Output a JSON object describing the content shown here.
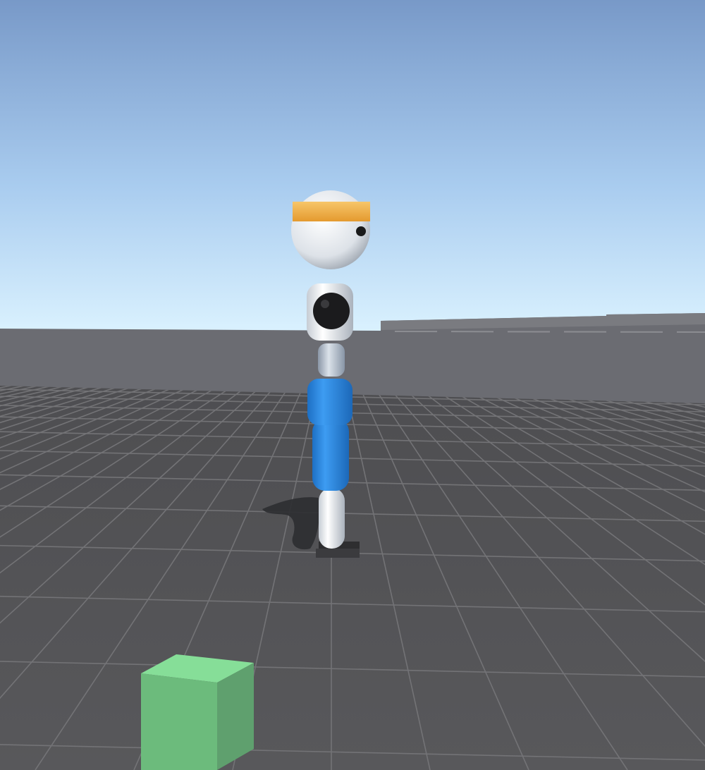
{
  "scene": {
    "type": "3d-game-view",
    "colors": {
      "sky_top": "#7a9ecb",
      "sky_horizon": "#d6f0ff",
      "wall": "#6d6e74",
      "floor": "#555558",
      "grid_line": "#7a7a7d",
      "robot_white": "#e8ecf0",
      "robot_blue": "#2a86e0",
      "headband": "#f2b04a",
      "eye": "#1a1a1a",
      "cube_front": "#6cbb7c",
      "cube_top": "#86de98",
      "cube_side": "#5ea06d",
      "shadow": "#2f3034"
    }
  }
}
